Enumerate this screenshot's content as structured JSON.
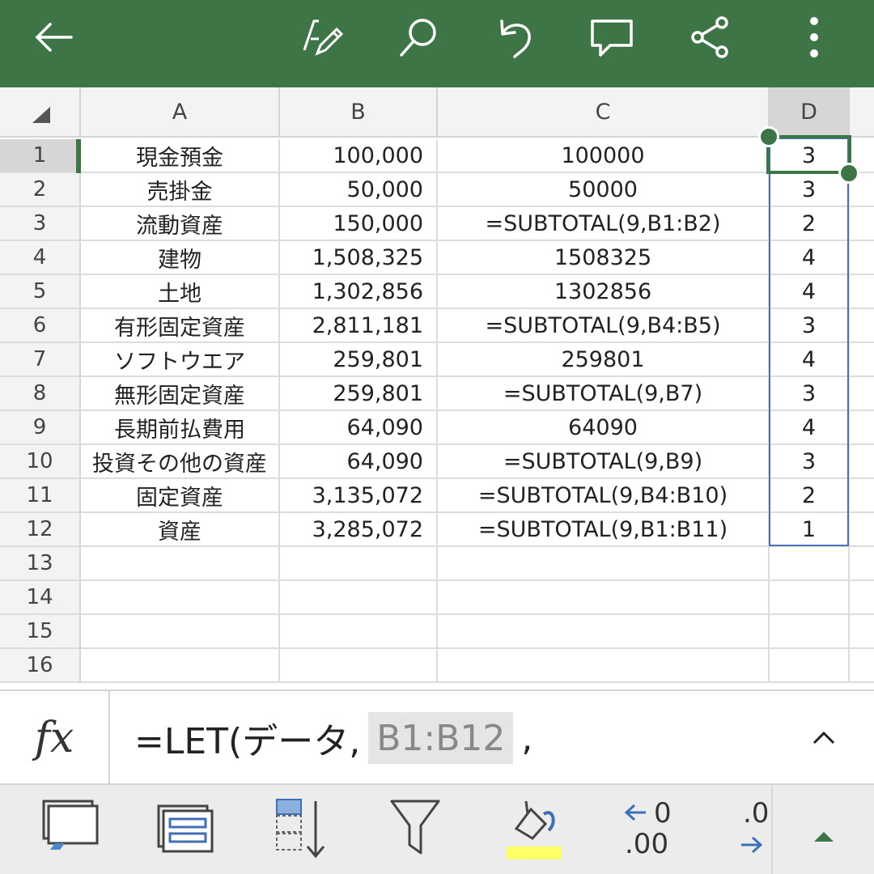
{
  "app": {
    "toolbar_icons": [
      "back-arrow-icon",
      "edit-pen-icon",
      "search-icon",
      "undo-icon",
      "comment-icon",
      "share-icon",
      "more-vertical-icon"
    ],
    "accent_color": "#3d7546",
    "selection_color": "#4a72b8"
  },
  "sheet": {
    "columns": [
      "A",
      "B",
      "C",
      "D"
    ],
    "active_column": "D",
    "active_row": "1",
    "rows": [
      {
        "num": "1",
        "a": "現金預金",
        "b": "100,000",
        "c": "100000",
        "d": "3"
      },
      {
        "num": "2",
        "a": "売掛金",
        "b": "50,000",
        "c": "50000",
        "d": "3"
      },
      {
        "num": "3",
        "a": "流動資産",
        "b": "150,000",
        "c": "=SUBTOTAL(9,B1:B2)",
        "d": "2"
      },
      {
        "num": "4",
        "a": "建物",
        "b": "1,508,325",
        "c": "1508325",
        "d": "4"
      },
      {
        "num": "5",
        "a": "土地",
        "b": "1,302,856",
        "c": "1302856",
        "d": "4"
      },
      {
        "num": "6",
        "a": "有形固定資産",
        "b": "2,811,181",
        "c": "=SUBTOTAL(9,B4:B5)",
        "d": "3"
      },
      {
        "num": "7",
        "a": "ソフトウエア",
        "b": "259,801",
        "c": "259801",
        "d": "4"
      },
      {
        "num": "8",
        "a": "無形固定資産",
        "b": "259,801",
        "c": "=SUBTOTAL(9,B7)",
        "d": "3"
      },
      {
        "num": "9",
        "a": "長期前払費用",
        "b": "64,090",
        "c": "64090",
        "d": "4"
      },
      {
        "num": "10",
        "a": "投資その他の資産",
        "b": "64,090",
        "c": "=SUBTOTAL(9,B9)",
        "d": "3"
      },
      {
        "num": "11",
        "a": "固定資産",
        "b": "3,135,072",
        "c": "=SUBTOTAL(9,B4:B10)",
        "d": "2"
      },
      {
        "num": "12",
        "a": "資産",
        "b": "3,285,072",
        "c": "=SUBTOTAL(9,B1:B11)",
        "d": "1"
      },
      {
        "num": "13",
        "a": "",
        "b": "",
        "c": "",
        "d": ""
      },
      {
        "num": "14",
        "a": "",
        "b": "",
        "c": "",
        "d": ""
      },
      {
        "num": "15",
        "a": "",
        "b": "",
        "c": "",
        "d": ""
      },
      {
        "num": "16",
        "a": "",
        "b": "",
        "c": "",
        "d": ""
      }
    ]
  },
  "formula_bar": {
    "fx_label": "fx",
    "prefix": "=LET(データ,",
    "reference": "B1:B12",
    "suffix": ","
  },
  "bottom_toolbar": {
    "tools": [
      "format-cells-icon",
      "table-style-icon",
      "sort-icon",
      "filter-icon",
      "fill-color-icon",
      "decrease-decimal-icon",
      "increase-decimal-icon",
      "expand-up-icon"
    ],
    "decrease_decimal_top": "0",
    "decrease_decimal_bottom": ".00",
    "increase_decimal_top": ".0",
    "fill_color": "#ffff66"
  }
}
